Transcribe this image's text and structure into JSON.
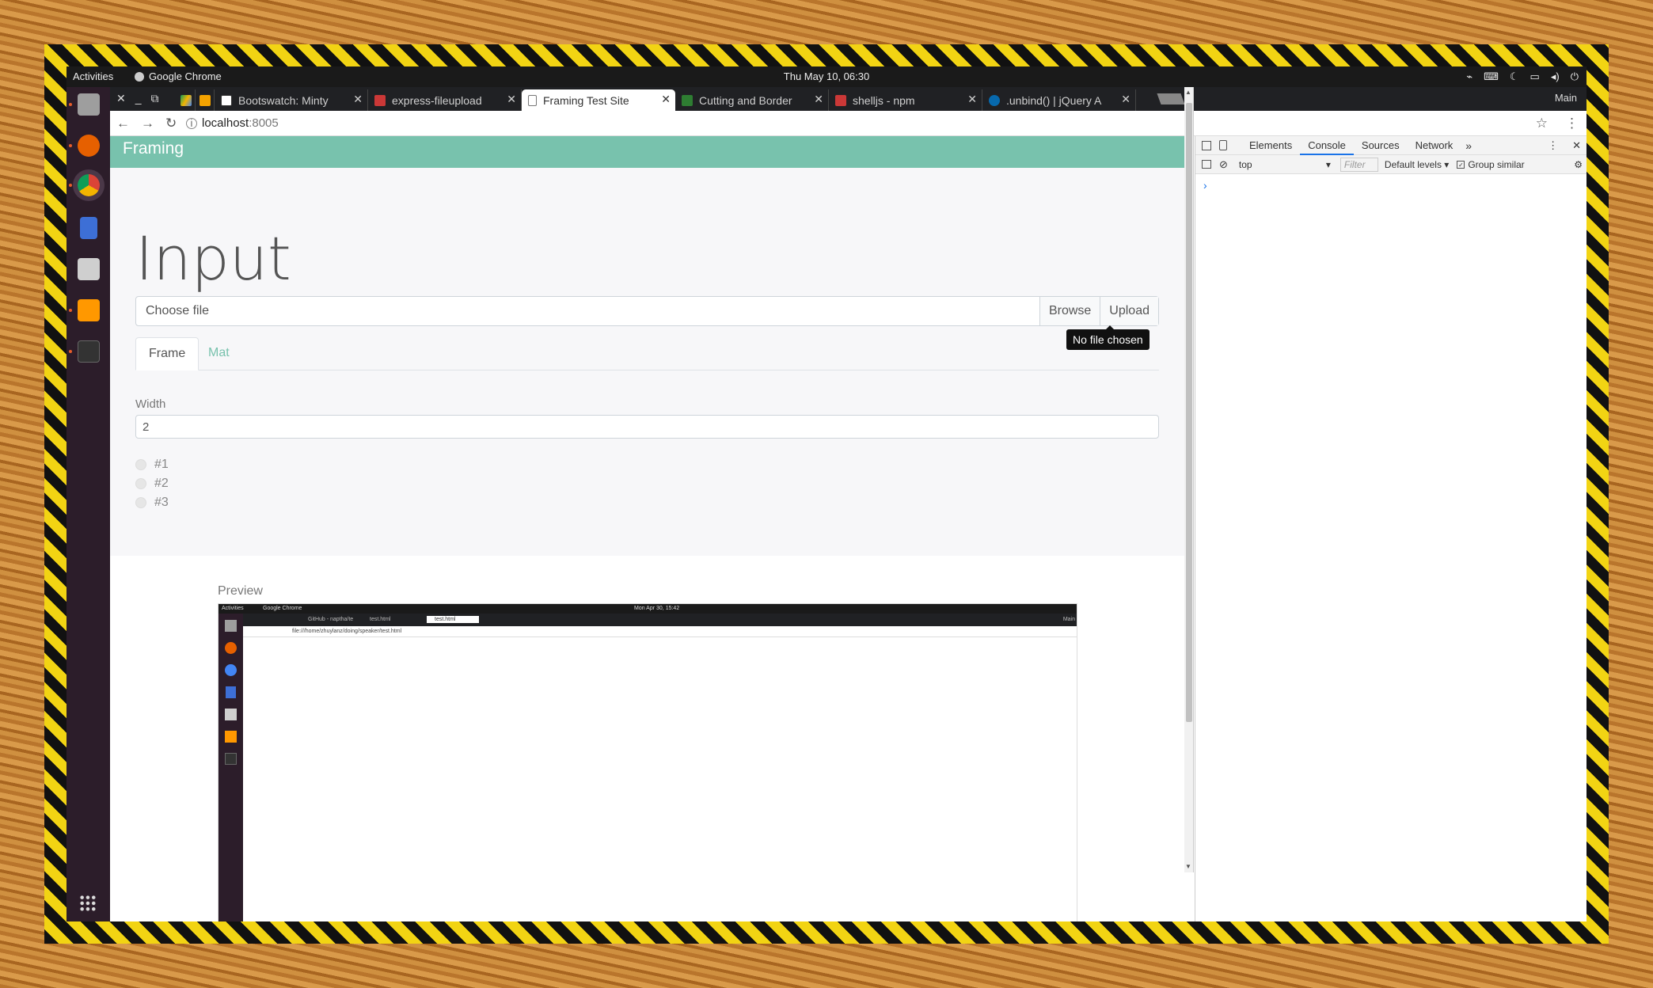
{
  "desktop": {
    "activities": "Activities",
    "app_name": "Google Chrome",
    "clock": "Thu May 10, 06:30",
    "dock_items": [
      {
        "icon": "files-icon",
        "color": "#9e9e9e"
      },
      {
        "icon": "firefox-icon",
        "color": "#e66000"
      },
      {
        "icon": "chrome-icon",
        "color": "#4285f4"
      },
      {
        "icon": "document-icon",
        "color": "#3d6fd6"
      },
      {
        "icon": "software-center-icon",
        "color": "#cfcfcf"
      },
      {
        "icon": "sublime-text-icon",
        "color": "#ff9800"
      },
      {
        "icon": "terminal-icon",
        "color": "#333333"
      }
    ],
    "apps_grid_icon": "grid-icon"
  },
  "browser": {
    "tabs": [
      {
        "title": "Bootswatch: Minty",
        "fav": "#333333"
      },
      {
        "title": "express-fileupload",
        "fav": "#cb3837"
      },
      {
        "title": "Framing Test Site",
        "fav": "#ffffff",
        "active": true
      },
      {
        "title": "Cutting and Border",
        "fav": "#2e7d32"
      },
      {
        "title": "shelljs - npm",
        "fav": "#cb3837"
      },
      {
        "title": ".unbind() | jQuery A",
        "fav": "#0769ad"
      }
    ],
    "window_label": "Main",
    "url_host": "localhost",
    "url_port": ":8005"
  },
  "page": {
    "brand": "Framing",
    "heading": "Input",
    "file_label": "Choose file",
    "browse_label": "Browse",
    "upload_label": "Upload",
    "tooltip": "No file chosen",
    "tabs": [
      "Frame",
      "Mat"
    ],
    "width_label": "Width",
    "width_value": "2",
    "radios": [
      "#1",
      "#2",
      "#3"
    ],
    "preview_label": "Preview",
    "preview": {
      "activities": "Activities",
      "app_name": "Google Chrome",
      "clock": "Mon Apr 30, 15:42",
      "tabs": [
        "GitHub - naptha/te",
        "test.html",
        "test.html"
      ],
      "url": "file:///home/zhuylanz/doing/speaker/test.html",
      "window_label": "Main"
    }
  },
  "devtools": {
    "tabs": [
      "Elements",
      "Console",
      "Sources",
      "Network"
    ],
    "active_tab": "Console",
    "context": "top",
    "filter_placeholder": "Filter",
    "levels": "Default levels",
    "group_similar": "Group similar",
    "prompt": "›"
  }
}
